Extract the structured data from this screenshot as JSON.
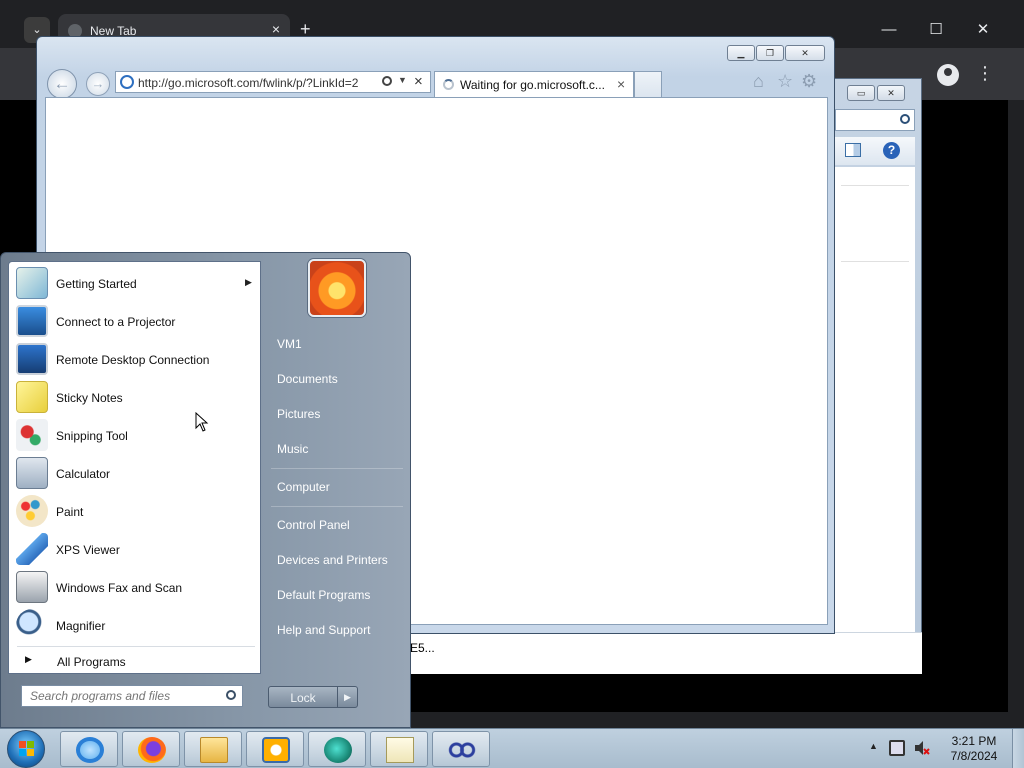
{
  "chrome": {
    "tab_title": "New Tab",
    "tab_close": "×",
    "new_tab": "+",
    "minimize": "—",
    "maximize": "☐",
    "close": "✕",
    "menu_kebab": "⋮",
    "tab_list": "⌄"
  },
  "ie": {
    "address": "http://go.microsoft.com/fwlink/p/?LinkId=2",
    "tab_title": "Waiting for go.microsoft.c...",
    "tab_close": "×",
    "stop": "×",
    "back": "←",
    "forward": "→"
  },
  "behind": {
    "snippet": "E5..."
  },
  "start_menu": {
    "programs": [
      {
        "label": "Getting Started",
        "icon": "getting-started-icon",
        "submenu": true
      },
      {
        "label": "Connect to a Projector",
        "icon": "projector-icon"
      },
      {
        "label": "Remote Desktop Connection",
        "icon": "remote-desktop-icon"
      },
      {
        "label": "Sticky Notes",
        "icon": "sticky-notes-icon"
      },
      {
        "label": "Snipping Tool",
        "icon": "scissors-icon"
      },
      {
        "label": "Calculator",
        "icon": "calculator-icon"
      },
      {
        "label": "Paint",
        "icon": "paint-palette-icon"
      },
      {
        "label": "XPS Viewer",
        "icon": "xps-viewer-icon"
      },
      {
        "label": "Windows Fax and Scan",
        "icon": "fax-icon"
      },
      {
        "label": "Magnifier",
        "icon": "magnifier-icon"
      }
    ],
    "all_programs": "All Programs",
    "search_placeholder": "Search programs and files",
    "right_items": [
      "VM1",
      "Documents",
      "Pictures",
      "Music",
      "Computer",
      "Control Panel",
      "Devices and Printers",
      "Default Programs",
      "Help and Support"
    ],
    "lock_label": "Lock"
  },
  "taskbar": {
    "time": "3:21 PM",
    "date": "7/8/2024",
    "pinned": [
      "internet-explorer-icon",
      "firefox-icon",
      "file-explorer-icon",
      "media-player-icon",
      "app-green-icon",
      "notepad-chart-icon",
      "infinity-app-icon"
    ]
  }
}
